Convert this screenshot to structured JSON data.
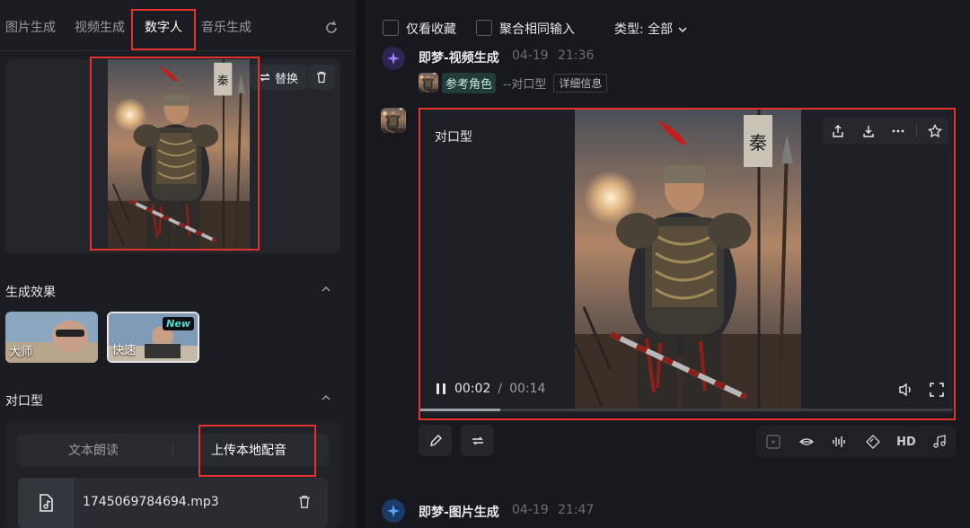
{
  "tabs": [
    "图片生成",
    "视频生成",
    "数字人",
    "音乐生成"
  ],
  "left": {
    "replace_label": "替换",
    "effect_section": "生成效果",
    "effects": [
      {
        "label": "大师"
      },
      {
        "label": "快速",
        "badge": "New"
      }
    ],
    "lipsync_section": "对口型",
    "modes": [
      "文本朗读",
      "上传本地配音"
    ],
    "file_name": "1745069784694.mp3"
  },
  "filters": {
    "favorites_only": "仅看收藏",
    "merge_same_input": "聚合相同输入",
    "type_label": "类型: 全部"
  },
  "messages": [
    {
      "source": "即梦-视频生成",
      "date": "04-19",
      "time": "21:36",
      "ref_label": "参考角色",
      "ref_type": "--对口型",
      "detail_label": "详细信息"
    },
    {
      "source": "即梦-图片生成",
      "date": "04-19",
      "time": "21:47"
    }
  ],
  "video": {
    "label": "对口型",
    "current_time": "00:02",
    "separator": "/",
    "duration": "00:14",
    "progress": 0.15
  },
  "toolbar_hd": "HD",
  "banner_char": "秦",
  "colors": {
    "accent_red": "#e5322d",
    "teal": "#4ee0d0",
    "brand_blue": "#3a7bf0"
  }
}
